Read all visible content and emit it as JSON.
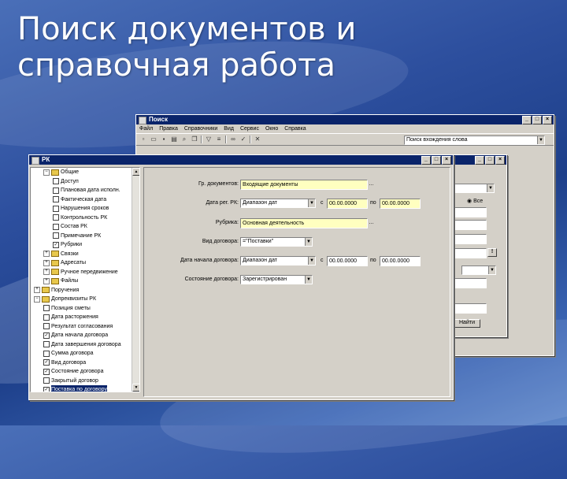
{
  "slide": {
    "title_line1": "Поиск документов и",
    "title_line2": "справочная работа"
  },
  "back_window": {
    "title": "Поиск",
    "menu": [
      "Файл",
      "Правка",
      "Справочники",
      "Вид",
      "Сервис",
      "Окно",
      "Справка"
    ],
    "search_combo": "Поиск вхождения слова",
    "controls": [
      "_",
      "□",
      "×"
    ]
  },
  "mid_window": {
    "title": "",
    "controls": [
      "_",
      "□",
      "×"
    ],
    "radio_label": "Все",
    "search_button": "Найти"
  },
  "rk_window": {
    "title": "РК",
    "controls": [
      "_",
      "□",
      "×"
    ],
    "tree": [
      {
        "label": "Общие",
        "level": 1,
        "type": "folder",
        "expander": "−"
      },
      {
        "label": "Доступ",
        "level": 2,
        "type": "check",
        "checked": false
      },
      {
        "label": "Плановая дата исполн.",
        "level": 2,
        "type": "check",
        "checked": false
      },
      {
        "label": "Фактическая дата",
        "level": 2,
        "type": "check",
        "checked": false
      },
      {
        "label": "Нарушения сроков",
        "level": 2,
        "type": "check",
        "checked": false
      },
      {
        "label": "Контрольность РК",
        "level": 2,
        "type": "check",
        "checked": false
      },
      {
        "label": "Состав РК",
        "level": 2,
        "type": "check",
        "checked": false
      },
      {
        "label": "Примечание РК",
        "level": 2,
        "type": "check",
        "checked": false
      },
      {
        "label": "Рубрики",
        "level": 2,
        "type": "check",
        "checked": true
      },
      {
        "label": "Связки",
        "level": 1,
        "type": "folder",
        "expander": "+"
      },
      {
        "label": "Адресаты",
        "level": 1,
        "type": "folder",
        "expander": "+"
      },
      {
        "label": "Ручное передвижение",
        "level": 1,
        "type": "folder",
        "expander": "+"
      },
      {
        "label": "Файлы",
        "level": 1,
        "type": "folder",
        "expander": "+"
      },
      {
        "label": "Поручения",
        "level": 0,
        "type": "folder",
        "expander": "+"
      },
      {
        "label": "Допреквизиты РК",
        "level": 0,
        "type": "folder",
        "expander": "−"
      },
      {
        "label": "Позиция сметы",
        "level": 1,
        "type": "check",
        "checked": false
      },
      {
        "label": "Дата расторжения",
        "level": 1,
        "type": "check",
        "checked": false
      },
      {
        "label": "Результат согласования",
        "level": 1,
        "type": "check",
        "checked": false
      },
      {
        "label": "Дата начала договора",
        "level": 1,
        "type": "check",
        "checked": true
      },
      {
        "label": "Дата завершения договора",
        "level": 1,
        "type": "check",
        "checked": false
      },
      {
        "label": "Сумма договора",
        "level": 1,
        "type": "check",
        "checked": false
      },
      {
        "label": "Вид договора",
        "level": 1,
        "type": "check",
        "checked": true
      },
      {
        "label": "Состояние договора",
        "level": 1,
        "type": "check",
        "checked": true
      },
      {
        "label": "Закрытый договор",
        "level": 1,
        "type": "check",
        "checked": false
      },
      {
        "label": "Поставка по договору",
        "level": 1,
        "type": "check",
        "checked": true,
        "selected": true
      }
    ],
    "form": {
      "doc_group_label": "Гр. документов:",
      "doc_group_value": "Входящие документы",
      "reg_date_label": "Дата рег. РК:",
      "reg_date_mode": "Диапазон дат",
      "reg_date_from": "00.00.0000",
      "reg_date_to": "00.00.0000",
      "rubric_label": "Рубрика:",
      "rubric_value": "Основная деятельность",
      "contract_type_label": "Вид договора:",
      "contract_type_value": "=\"Поставки\"",
      "contract_start_label": "Дата начала договора:",
      "contract_start_mode": "Диапазон дат",
      "contract_start_from": "00.00.0000",
      "contract_start_to": "00.00.0000",
      "contract_state_label": "Состояние договора:",
      "contract_state_value": "Зарегистрирован",
      "from_word": "с",
      "to_word": "по",
      "ellipsis": "...",
      "browse": "…"
    }
  }
}
